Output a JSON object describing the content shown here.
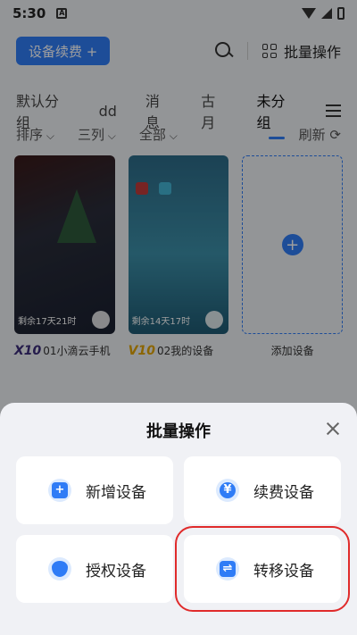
{
  "status_bar": {
    "time": "5:30",
    "notif": "A"
  },
  "header": {
    "renew_label": "设备续费 +",
    "batch_label": "批量操作"
  },
  "tabs": [
    {
      "label": "默认分组",
      "active": false
    },
    {
      "label": "dd",
      "active": false
    },
    {
      "label": "消息",
      "active": false
    },
    {
      "label": "古月",
      "active": false
    },
    {
      "label": "未分组",
      "active": true
    }
  ],
  "filters": {
    "sort": "排序",
    "columns": "三列",
    "all": "全部",
    "refresh": "刷新 ⟳"
  },
  "devices": [
    {
      "remaining": "剩余17天21时",
      "badge": "X10",
      "name": "01小滴云手机"
    },
    {
      "remaining": "剩余14天17时",
      "badge": "V10",
      "name": "02我的设备"
    }
  ],
  "add_device": {
    "icon": "+",
    "label": "添加设备"
  },
  "sheet": {
    "title": "批量操作",
    "ops": [
      {
        "label": "新增设备",
        "icon": "plus-icon",
        "glyph": "+"
      },
      {
        "label": "续费设备",
        "icon": "yen-icon",
        "glyph": "¥"
      },
      {
        "label": "授权设备",
        "icon": "shield-icon",
        "glyph": ""
      },
      {
        "label": "转移设备",
        "icon": "transfer-icon",
        "glyph": "⇌"
      }
    ]
  },
  "colors": {
    "accent": "#2f7cf6",
    "highlight": "#e02b2b"
  }
}
